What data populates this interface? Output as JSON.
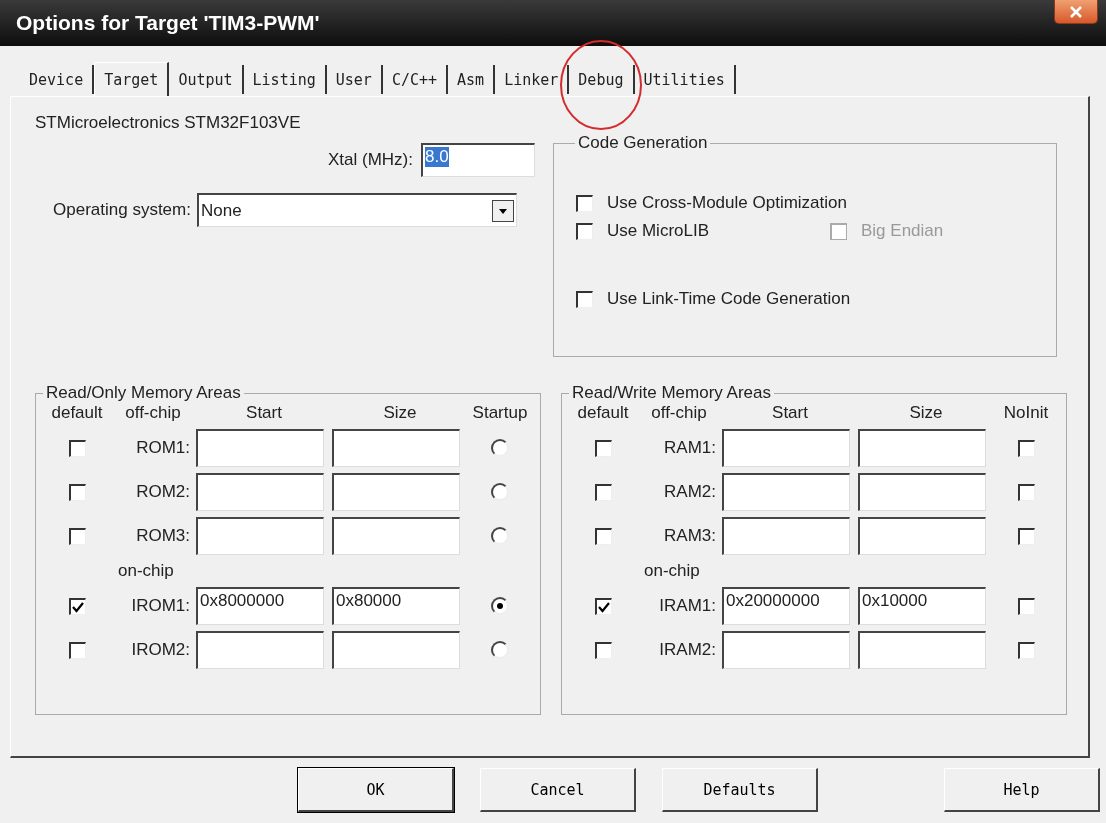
{
  "window": {
    "title": "Options for Target 'TIM3-PWM'"
  },
  "tabs": [
    {
      "label": "Device",
      "selected": false,
      "circled": false
    },
    {
      "label": "Target",
      "selected": true,
      "circled": false
    },
    {
      "label": "Output",
      "selected": false,
      "circled": false
    },
    {
      "label": "Listing",
      "selected": false,
      "circled": false
    },
    {
      "label": "User",
      "selected": false,
      "circled": false
    },
    {
      "label": "C/C++",
      "selected": false,
      "circled": false
    },
    {
      "label": "Asm",
      "selected": false,
      "circled": false
    },
    {
      "label": "Linker",
      "selected": false,
      "circled": false
    },
    {
      "label": "Debug",
      "selected": false,
      "circled": true
    },
    {
      "label": "Utilities",
      "selected": false,
      "circled": false
    }
  ],
  "device": "STMicroelectronics STM32F103VE",
  "xtal": {
    "label": "Xtal (MHz):",
    "value": "8.0",
    "highlighted": true
  },
  "operating_system": {
    "label": "Operating system:",
    "value": "None"
  },
  "code_generation": {
    "title": "Code Generation",
    "options": [
      {
        "label": "Use Cross-Module Optimization",
        "checked": false,
        "disabled": false
      },
      {
        "label": "Use MicroLIB",
        "checked": false,
        "disabled": false
      },
      {
        "label": "Big Endian",
        "checked": false,
        "disabled": true
      },
      {
        "label": "Use Link-Time Code Generation",
        "checked": false,
        "disabled": false
      }
    ]
  },
  "memory_groups": [
    {
      "title": "Read/Only Memory Areas",
      "kind": "radio",
      "headers": [
        "default",
        "off-chip",
        "Start",
        "Size",
        "Startup"
      ],
      "rows": [
        {
          "kind": "area",
          "label": "ROM1:",
          "start": "",
          "size": "",
          "default": false,
          "last": false
        },
        {
          "kind": "area",
          "label": "ROM2:",
          "start": "",
          "size": "",
          "default": false,
          "last": false
        },
        {
          "kind": "area",
          "label": "ROM3:",
          "start": "",
          "size": "",
          "default": false,
          "last": false
        },
        {
          "kind": "heading",
          "label": "on-chip"
        },
        {
          "kind": "area",
          "label": "IROM1:",
          "start": "0x8000000",
          "size": "0x80000",
          "default": true,
          "last": true
        },
        {
          "kind": "area",
          "label": "IROM2:",
          "start": "",
          "size": "",
          "default": false,
          "last": false
        }
      ]
    },
    {
      "title": "Read/Write Memory Areas",
      "kind": "checkbox",
      "headers": [
        "default",
        "off-chip",
        "Start",
        "Size",
        "NoInit"
      ],
      "rows": [
        {
          "kind": "area",
          "label": "RAM1:",
          "start": "",
          "size": "",
          "default": false,
          "last": false
        },
        {
          "kind": "area",
          "label": "RAM2:",
          "start": "",
          "size": "",
          "default": false,
          "last": false
        },
        {
          "kind": "area",
          "label": "RAM3:",
          "start": "",
          "size": "",
          "default": false,
          "last": false
        },
        {
          "kind": "heading",
          "label": "on-chip"
        },
        {
          "kind": "area",
          "label": "IRAM1:",
          "start": "0x20000000",
          "size": "0x10000",
          "default": true,
          "last": false
        },
        {
          "kind": "area",
          "label": "IRAM2:",
          "start": "",
          "size": "",
          "default": false,
          "last": false
        }
      ]
    }
  ],
  "buttons": [
    {
      "label": "OK",
      "kind": "default"
    },
    {
      "label": "Cancel",
      "kind": "normal"
    },
    {
      "label": "Defaults",
      "kind": "normal"
    },
    {
      "label": "Help",
      "kind": "help"
    }
  ]
}
